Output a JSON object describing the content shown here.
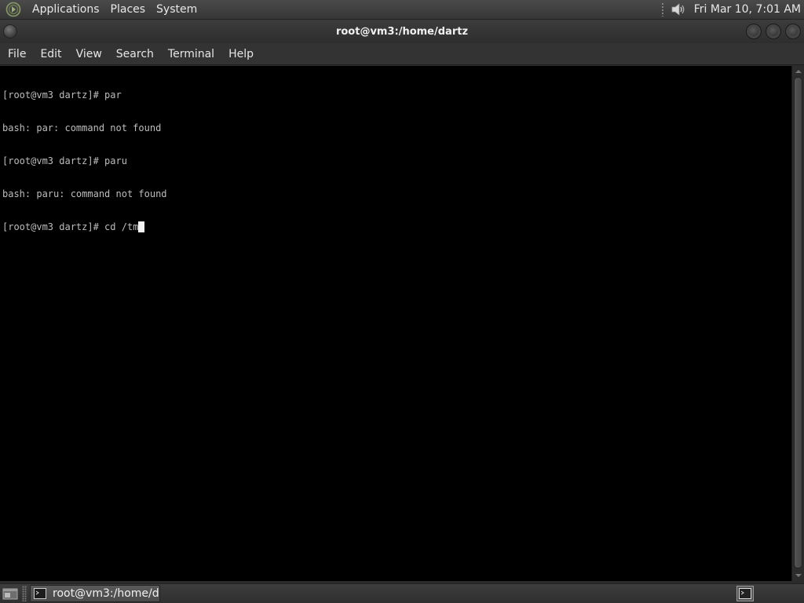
{
  "top_panel": {
    "menus": [
      "Applications",
      "Places",
      "System"
    ],
    "clock": "Fri Mar 10,  7:01 AM",
    "icons": {
      "logo": "distro-logo-icon",
      "volume": "volume-icon"
    }
  },
  "window": {
    "title": "root@vm3:/home/dartz",
    "menu": [
      "File",
      "Edit",
      "View",
      "Search",
      "Terminal",
      "Help"
    ]
  },
  "terminal": {
    "lines": [
      "[root@vm3 dartz]# par",
      "bash: par: command not found",
      "[root@vm3 dartz]# paru",
      "bash: paru: command not found",
      "[root@vm3 dartz]# cd /tm"
    ],
    "colors": {
      "background": "#000000",
      "text": "#bdbdbd",
      "cursor": "#f2f2f2"
    }
  },
  "bottom_panel": {
    "task_label": "root@vm3:/home/d...",
    "icons": {
      "show_desktop": "show-desktop-icon",
      "task": "terminal-icon",
      "workspace": "workspace-switcher-icon"
    }
  }
}
